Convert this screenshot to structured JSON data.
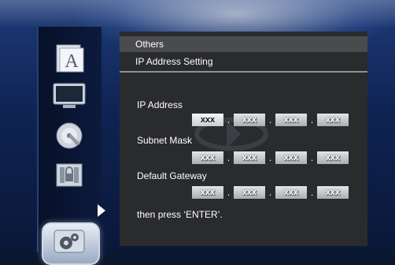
{
  "sidebar": {
    "items": [
      {
        "icon": "language-a-icon"
      },
      {
        "icon": "display-monitor-icon"
      },
      {
        "icon": "disc-icon"
      },
      {
        "icon": "parental-lock-icon"
      },
      {
        "icon": "settings-gears-icon"
      }
    ]
  },
  "panel": {
    "header": "Others",
    "subheader": "IP Address Setting",
    "ip_address": {
      "label": "IP Address",
      "octets": [
        "xxx",
        "xxx",
        "xxx",
        "xxx"
      ],
      "separator": "."
    },
    "subnet_mask": {
      "label": "Subnet Mask",
      "octets": [
        "xxx",
        "xxx",
        "xxx",
        "xxx"
      ],
      "separator": "."
    },
    "default_gateway": {
      "label": "Default Gateway",
      "octets": [
        "xxx",
        "xxx",
        "xxx",
        "xxx"
      ],
      "separator": "."
    },
    "footer": "then press ‘ENTER’."
  },
  "colors": {
    "background": "#0f2352",
    "panel": "#2a2b2d",
    "header": "#4a4b4e",
    "field": "#c9cdd2"
  }
}
